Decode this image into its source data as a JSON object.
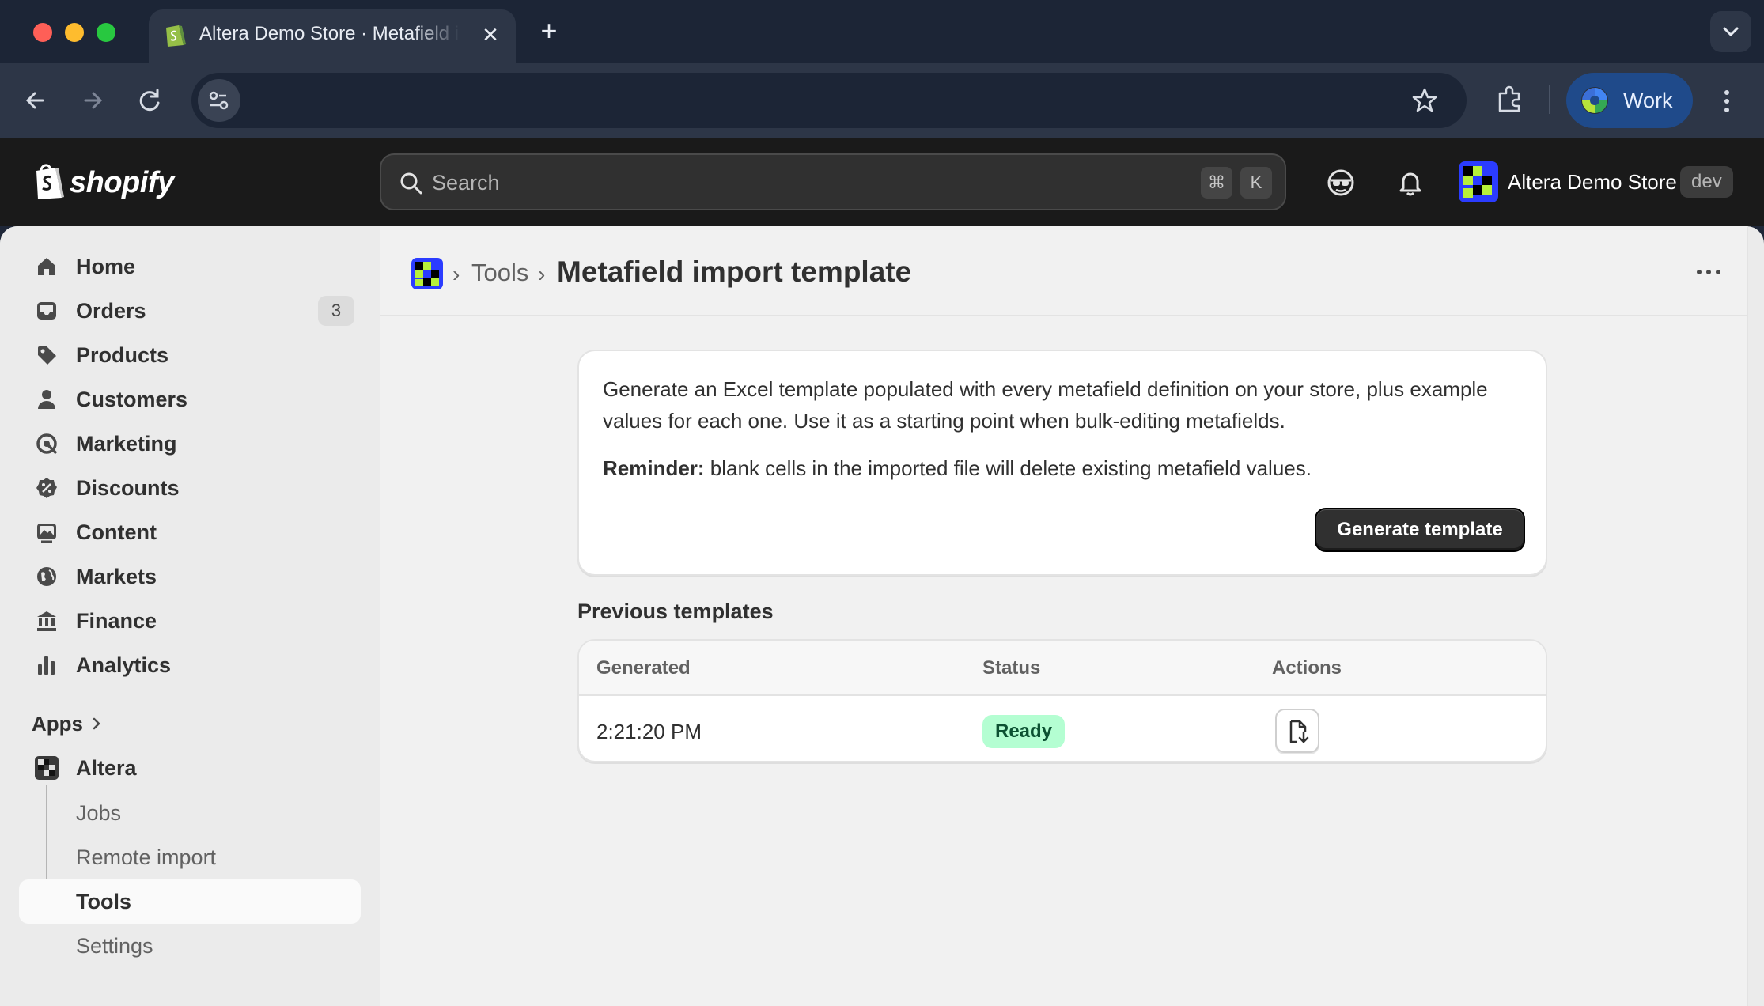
{
  "browser": {
    "tab_title": "Altera Demo Store · Metafield import template",
    "profile_label": "Work"
  },
  "topbar": {
    "logo_text": "shopify",
    "search_placeholder": "Search",
    "shortcut_cmd": "⌘",
    "shortcut_key": "K",
    "store_name": "Altera Demo Store",
    "store_badge": "dev"
  },
  "sidebar": {
    "items": [
      {
        "label": "Home",
        "icon": "home-icon"
      },
      {
        "label": "Orders",
        "icon": "inbox-icon",
        "count": "3"
      },
      {
        "label": "Products",
        "icon": "tag-icon"
      },
      {
        "label": "Customers",
        "icon": "person-icon"
      },
      {
        "label": "Marketing",
        "icon": "target-icon"
      },
      {
        "label": "Discounts",
        "icon": "discount-icon"
      },
      {
        "label": "Content",
        "icon": "image-icon"
      },
      {
        "label": "Markets",
        "icon": "globe-icon"
      },
      {
        "label": "Finance",
        "icon": "bank-icon"
      },
      {
        "label": "Analytics",
        "icon": "bar-chart-icon"
      }
    ],
    "apps_label": "Apps",
    "app_name": "Altera",
    "app_subitems": [
      {
        "label": "Jobs"
      },
      {
        "label": "Remote import"
      },
      {
        "label": "Tools",
        "active": true
      },
      {
        "label": "Settings"
      }
    ]
  },
  "page": {
    "breadcrumb_parent": "Tools",
    "title": "Metafield import template",
    "description": "Generate an Excel template populated with every metafield definition on your store, plus example values for each one. Use it as a starting point when bulk-editing metafields.",
    "reminder_label": "Reminder:",
    "reminder_text": " blank cells in the imported file will delete existing metafield values.",
    "generate_button": "Generate template",
    "previous_title": "Previous templates",
    "table": {
      "columns": [
        "Generated",
        "Status",
        "Actions"
      ],
      "rows": [
        {
          "generated": "2:21:20 PM",
          "status": "Ready"
        }
      ]
    }
  },
  "colors": {
    "accent_dark": "#303030",
    "ready_bg": "#b4fed2",
    "ready_fg": "#0c5132"
  }
}
